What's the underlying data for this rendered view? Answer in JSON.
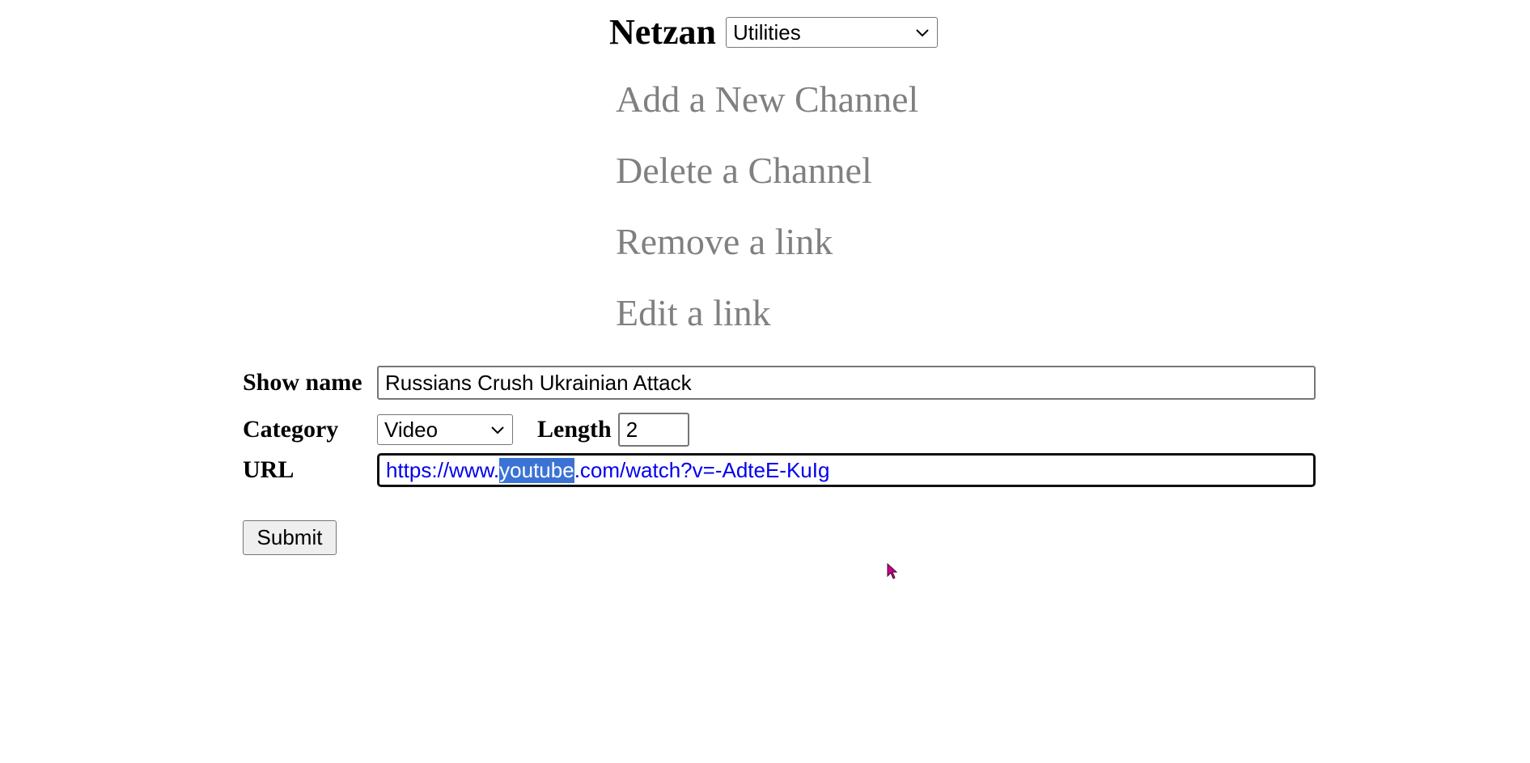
{
  "header": {
    "title": "Netzan",
    "menu_select": {
      "selected": "Utilities"
    }
  },
  "utilities_menu": {
    "items": [
      {
        "label": "Add a New Channel"
      },
      {
        "label": "Delete a Channel"
      },
      {
        "label": "Remove a link"
      },
      {
        "label": "Edit a link"
      }
    ]
  },
  "form": {
    "show_name": {
      "label": "Show name",
      "value": "Russians Crush Ukrainian Attack"
    },
    "category": {
      "label": "Category",
      "selected": "Video"
    },
    "length": {
      "label": "Length",
      "value": "2"
    },
    "url": {
      "label": "URL",
      "value_prefix": "https://www.",
      "value_selected": "youtube",
      "value_suffix": ".com/watch?v=-AdteE-KuIg"
    },
    "submit_label": "Submit"
  },
  "colors": {
    "menu_link": "#808080",
    "url_text": "#0000ee",
    "selection_highlight": "#3b73d4",
    "cursor": "#c8008c"
  },
  "icons": {
    "dropdown": "chevron-down-icon",
    "pointer": "mouse-pointer-icon"
  }
}
